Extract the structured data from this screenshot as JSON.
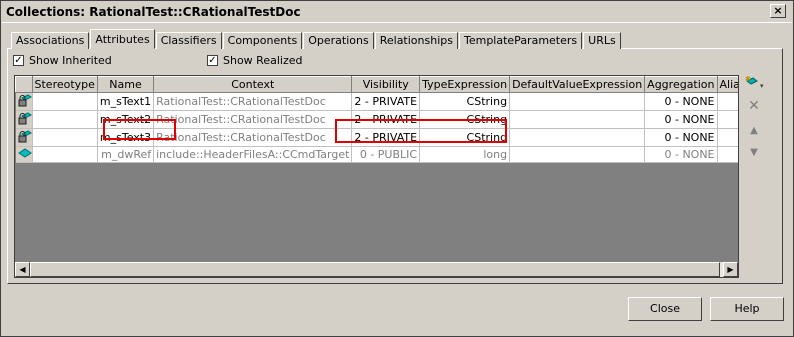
{
  "title": "Collections: RationalTest::CRationalTestDoc",
  "close_glyph": "×",
  "tabs": [
    "Associations",
    "Attributes",
    "Classifiers",
    "Components",
    "Operations",
    "Relationships",
    "TemplateParameters",
    "URLs"
  ],
  "active_tab": "Attributes",
  "show_inherited": {
    "label": "Show Inherited",
    "checked": true
  },
  "show_realized": {
    "label": "Show Realized",
    "checked": true
  },
  "columns": [
    "",
    "Stereotype",
    "Name",
    "Context",
    "Visibility",
    "TypeExpression",
    "DefaultValueExpression",
    "Aggregation",
    "Alias",
    ""
  ],
  "rows": [
    {
      "icon": "attribute-private-icon",
      "stereotype": "",
      "name": "m_sText1",
      "context": "RationalTest::CRationalTestDoc",
      "visibility": "2 - PRIVATE",
      "type": "CString",
      "default": "",
      "aggregation": "0 - NONE",
      "alias": "",
      "extra": "(",
      "inherited": false
    },
    {
      "icon": "attribute-private-icon",
      "stereotype": "",
      "name": "m_sText2",
      "context": "RationalTest::CRationalTestDoc",
      "visibility": "2 - PRIVATE",
      "type": "CString",
      "default": "",
      "aggregation": "0 - NONE",
      "alias": "",
      "extra": "(",
      "inherited": false
    },
    {
      "icon": "attribute-private-icon",
      "stereotype": "",
      "name": "m_sText3",
      "context": "RationalTest::CRationalTestDoc",
      "visibility": "2 - PRIVATE",
      "type": "CString",
      "default": "",
      "aggregation": "0 - NONE",
      "alias": "",
      "extra": "(",
      "inherited": false
    },
    {
      "icon": "attribute-public-icon",
      "stereotype": "",
      "name": "m_dwRef",
      "context": "include::HeaderFilesA::CCmdTarget",
      "visibility": "0 - PUBLIC",
      "type": "long",
      "default": "",
      "aggregation": "0 - NONE",
      "alias": "",
      "extra": "(",
      "inherited": true
    }
  ],
  "side_tools": [
    "new-attribute-icon",
    "delete-icon",
    "move-up-icon",
    "move-down-icon"
  ],
  "buttons": {
    "close": "Close",
    "help": "Help"
  },
  "colors": {
    "highlight": "#e00000",
    "window": "#d4d0c8",
    "grid_empty": "#808080"
  }
}
